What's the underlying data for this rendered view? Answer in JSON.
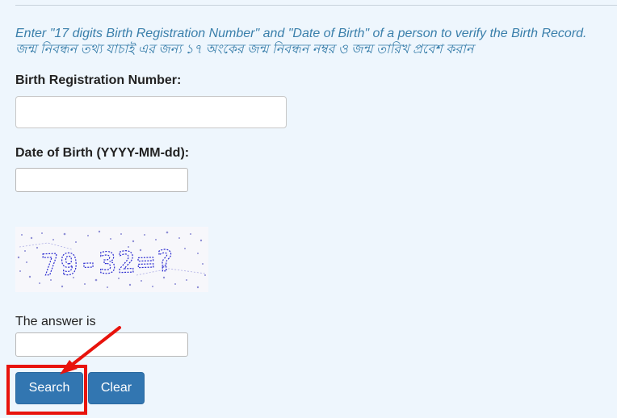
{
  "instructions": {
    "english": "Enter \"17 digits Birth Registration Number\" and \"Date of Birth\" of a person to verify the Birth Record.",
    "bangla": "জন্ম নিবন্ধন তথ্য যাচাই এর জন্য ১৭ অংকের জন্ম নিবন্ধন নম্বর ও জন্ম তারিখ প্রবেশ করান"
  },
  "form": {
    "birth_registration_label": "Birth Registration Number:",
    "birth_registration_value": "",
    "dob_label": "Date of Birth (YYYY-MM-dd):",
    "dob_value": "",
    "captcha_text": "79-32=?",
    "answer_label": "The answer is",
    "answer_value": ""
  },
  "buttons": {
    "search_label": "Search",
    "clear_label": "Clear"
  },
  "annotation": {
    "highlight_color": "#e8130c"
  }
}
